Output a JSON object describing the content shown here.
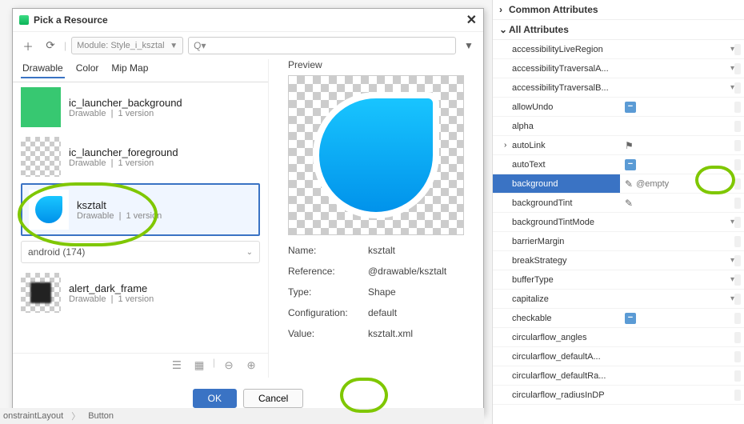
{
  "dialog": {
    "title": "Pick a Resource",
    "module_selector": "Module: Style_i_ksztal",
    "search_placeholder": "",
    "tabs": [
      "Drawable",
      "Color",
      "Mip Map"
    ],
    "active_tab": 0,
    "resources": [
      {
        "name": "ic_launcher_background",
        "type": "Drawable",
        "versions": "1 version",
        "thumb": "green"
      },
      {
        "name": "ic_launcher_foreground",
        "type": "Drawable",
        "versions": "1 version",
        "thumb": "checker"
      },
      {
        "name": "ksztalt",
        "type": "Drawable",
        "versions": "1 version",
        "thumb": "blueshape"
      }
    ],
    "group": "android (174)",
    "resources2": [
      {
        "name": "alert_dark_frame",
        "type": "Drawable",
        "versions": "1 version",
        "thumb": "darkframe"
      }
    ],
    "preview_label": "Preview",
    "details": {
      "name_label": "Name:",
      "name": "ksztalt",
      "ref_label": "Reference:",
      "ref": "@drawable/ksztalt",
      "type_label": "Type:",
      "type": "Shape",
      "config_label": "Configuration:",
      "config": "default",
      "value_label": "Value:",
      "value": "ksztalt.xml"
    },
    "buttons": {
      "ok": "OK",
      "cancel": "Cancel"
    }
  },
  "attr_panel": {
    "section1": "Common Attributes",
    "section2": "All Attributes",
    "rows": [
      {
        "key": "accessibilityLiveRegion",
        "ctl": "dropdown"
      },
      {
        "key": "accessibilityTraversalA...",
        "ctl": "dropdown"
      },
      {
        "key": "accessibilityTraversalB...",
        "ctl": "dropdown"
      },
      {
        "key": "allowUndo",
        "val_icon": "dash"
      },
      {
        "key": "alpha"
      },
      {
        "key": "autoLink",
        "chev": true,
        "val_icon": "flag"
      },
      {
        "key": "autoText",
        "val_icon": "dash"
      },
      {
        "key": "background",
        "selected": true,
        "val_icon": "edit",
        "val_text": "@empty"
      },
      {
        "key": "backgroundTint",
        "val_icon": "edit"
      },
      {
        "key": "backgroundTintMode",
        "ctl": "dropdown"
      },
      {
        "key": "barrierMargin"
      },
      {
        "key": "breakStrategy",
        "ctl": "dropdown"
      },
      {
        "key": "bufferType",
        "ctl": "dropdown"
      },
      {
        "key": "capitalize",
        "ctl": "dropdown"
      },
      {
        "key": "checkable",
        "val_icon": "dash"
      },
      {
        "key": "circularflow_angles"
      },
      {
        "key": "circularflow_defaultA..."
      },
      {
        "key": "circularflow_defaultRa..."
      },
      {
        "key": "circularflow_radiusInDP"
      }
    ]
  },
  "breadcrumb": [
    "onstraintLayout",
    "Button"
  ]
}
